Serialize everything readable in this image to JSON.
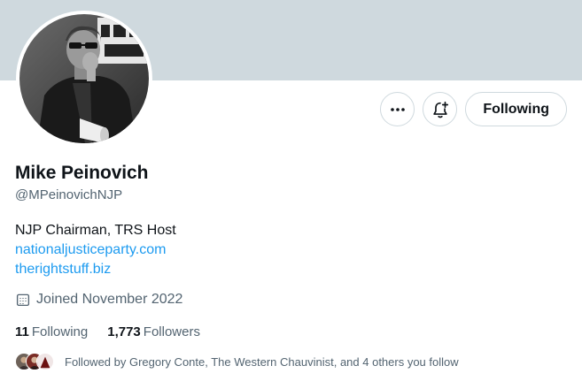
{
  "profile": {
    "name": "Mike Peinovich",
    "handle": "@MPeinovichNJP",
    "bio": "NJP Chairman, TRS Host",
    "links": [
      "nationaljusticeparty.com",
      "therightstuff.biz"
    ],
    "joined": "Joined November 2022"
  },
  "actions": {
    "more_icon": "more-icon",
    "notify_icon": "bell-plus-icon",
    "follow_label": "Following"
  },
  "stats": {
    "following_count": "11",
    "following_label": "Following",
    "followers_count": "1,773",
    "followers_label": "Followers"
  },
  "followed_by": {
    "text": "Followed by Gregory Conte, The Western Chauvinist, and 4 others you follow"
  },
  "colors": {
    "banner": "#cfd9de",
    "link": "#1d9bf0",
    "secondary_text": "#536471",
    "primary_text": "#0f1419"
  }
}
